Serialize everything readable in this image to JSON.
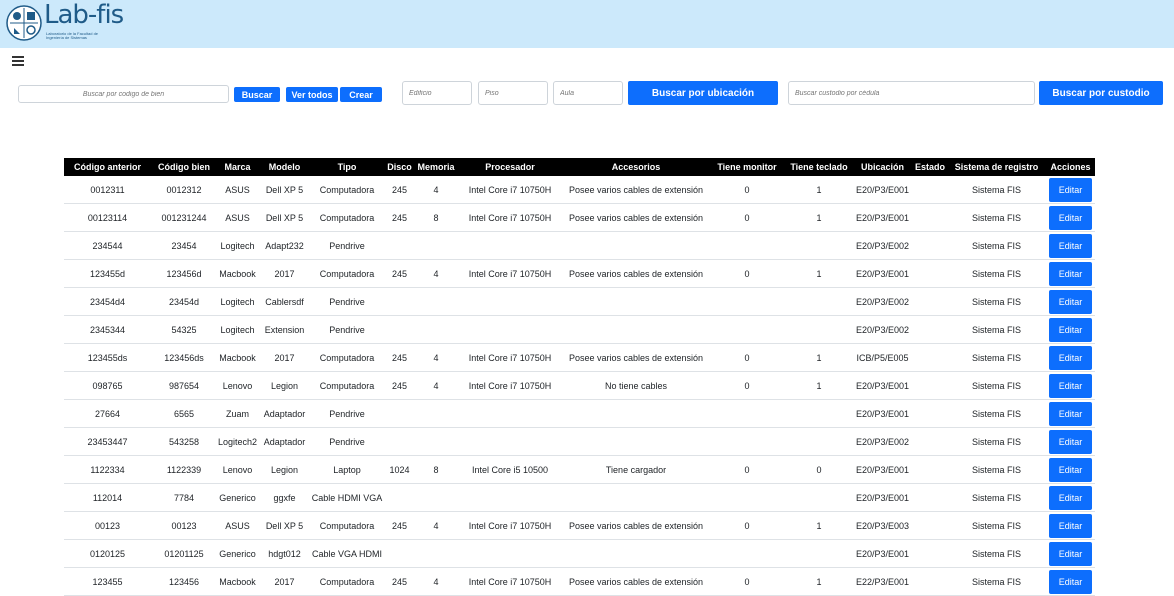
{
  "app": {
    "logo_text": "Lab-fis",
    "logo_subtitle": "Laboratorio de la Facultad de Ingeniería de Sistemas"
  },
  "search": {
    "code_placeholder": "Buscar por codigo de bien",
    "search_label": "Buscar",
    "view_all_label": "Ver todos",
    "create_label": "Crear",
    "building_placeholder": "Edificio",
    "floor_placeholder": "Piso",
    "room_placeholder": "Aula",
    "location_button_label": "Buscar por ubicación",
    "custodian_placeholder": "Buscar custodio por cédula",
    "custodian_button_label": "Buscar por custodio"
  },
  "table": {
    "headers": [
      "Código anterior",
      "Código bien",
      "Marca",
      "Modelo",
      "Tipo",
      "Disco",
      "Memoria",
      "Procesador",
      "Accesorios",
      "Tiene monitor",
      "Tiene teclado",
      "Ubicación",
      "Estado",
      "Sistema de registro",
      "Acciones"
    ],
    "action_label": "Editar",
    "rows": [
      [
        "0012311",
        "0012312",
        "ASUS",
        "Dell XP 5",
        "Computadora",
        "245",
        "4",
        "Intel Core i7 10750H",
        "Posee varios cables de extensión",
        "0",
        "1",
        "E20/P3/E001",
        "",
        "Sistema FIS"
      ],
      [
        "00123114",
        "001231244",
        "ASUS",
        "Dell XP 5",
        "Computadora",
        "245",
        "8",
        "Intel Core i7 10750H",
        "Posee varios cables de extensión",
        "0",
        "1",
        "E20/P3/E001",
        "",
        "Sistema FIS"
      ],
      [
        "234544",
        "23454",
        "Logitech",
        "Adapt232",
        "Pendrive",
        "",
        "",
        "",
        "",
        "",
        "",
        "E20/P3/E002",
        "",
        "Sistema FIS"
      ],
      [
        "123455d",
        "123456d",
        "Macbook",
        "2017",
        "Computadora",
        "245",
        "4",
        "Intel Core i7 10750H",
        "Posee varios cables de extensión",
        "0",
        "1",
        "E20/P3/E001",
        "",
        "Sistema FIS"
      ],
      [
        "23454d4",
        "23454d",
        "Logitech",
        "Cablersdf",
        "Pendrive",
        "",
        "",
        "",
        "",
        "",
        "",
        "E20/P3/E002",
        "",
        "Sistema FIS"
      ],
      [
        "2345344",
        "54325",
        "Logitech",
        "Extension",
        "Pendrive",
        "",
        "",
        "",
        "",
        "",
        "",
        "E20/P3/E002",
        "",
        "Sistema FIS"
      ],
      [
        "123455ds",
        "123456ds",
        "Macbook",
        "2017",
        "Computadora",
        "245",
        "4",
        "Intel Core i7 10750H",
        "Posee varios cables de extensión",
        "0",
        "1",
        "ICB/P5/E005",
        "",
        "Sistema FIS"
      ],
      [
        "098765",
        "987654",
        "Lenovo",
        "Legion",
        "Computadora",
        "245",
        "4",
        "Intel Core i7 10750H",
        "No tiene cables",
        "0",
        "1",
        "E20/P3/E001",
        "",
        "Sistema FIS"
      ],
      [
        "27664",
        "6565",
        "Zuam",
        "Adaptador",
        "Pendrive",
        "",
        "",
        "",
        "",
        "",
        "",
        "E20/P3/E001",
        "",
        "Sistema FIS"
      ],
      [
        "23453447",
        "543258",
        "Logitech2",
        "Adaptador",
        "Pendrive",
        "",
        "",
        "",
        "",
        "",
        "",
        "E20/P3/E002",
        "",
        "Sistema FIS"
      ],
      [
        "1122334",
        "1122339",
        "Lenovo",
        "Legion",
        "Laptop",
        "1024",
        "8",
        "Intel Core i5 10500",
        "Tiene cargador",
        "0",
        "0",
        "E20/P3/E001",
        "",
        "Sistema FIS"
      ],
      [
        "112014",
        "7784",
        "Generico",
        "ggxfe",
        "Cable HDMI VGA",
        "",
        "",
        "",
        "",
        "",
        "",
        "E20/P3/E001",
        "",
        "Sistema FIS"
      ],
      [
        "00123",
        "00123",
        "ASUS",
        "Dell XP 5",
        "Computadora",
        "245",
        "4",
        "Intel Core i7 10750H",
        "Posee varios cables de extensión",
        "0",
        "1",
        "E20/P3/E003",
        "",
        "Sistema FIS"
      ],
      [
        "0120125",
        "01201125",
        "Generico",
        "hdgt012",
        "Cable VGA HDMI",
        "",
        "",
        "",
        "",
        "",
        "",
        "E20/P3/E001",
        "",
        "Sistema FIS"
      ],
      [
        "123455",
        "123456",
        "Macbook",
        "2017",
        "Computadora",
        "245",
        "4",
        "Intel Core i7 10750H",
        "Posee varios cables de extensión",
        "0",
        "1",
        "E22/P3/E001",
        "",
        "Sistema FIS"
      ]
    ]
  },
  "colors": {
    "header_bar": "#cce9fb",
    "primary": "#0d6efd",
    "table_header": "#000000"
  },
  "icons": {
    "menu": "hamburger-icon",
    "logo": "faculty-emblem-icon"
  }
}
